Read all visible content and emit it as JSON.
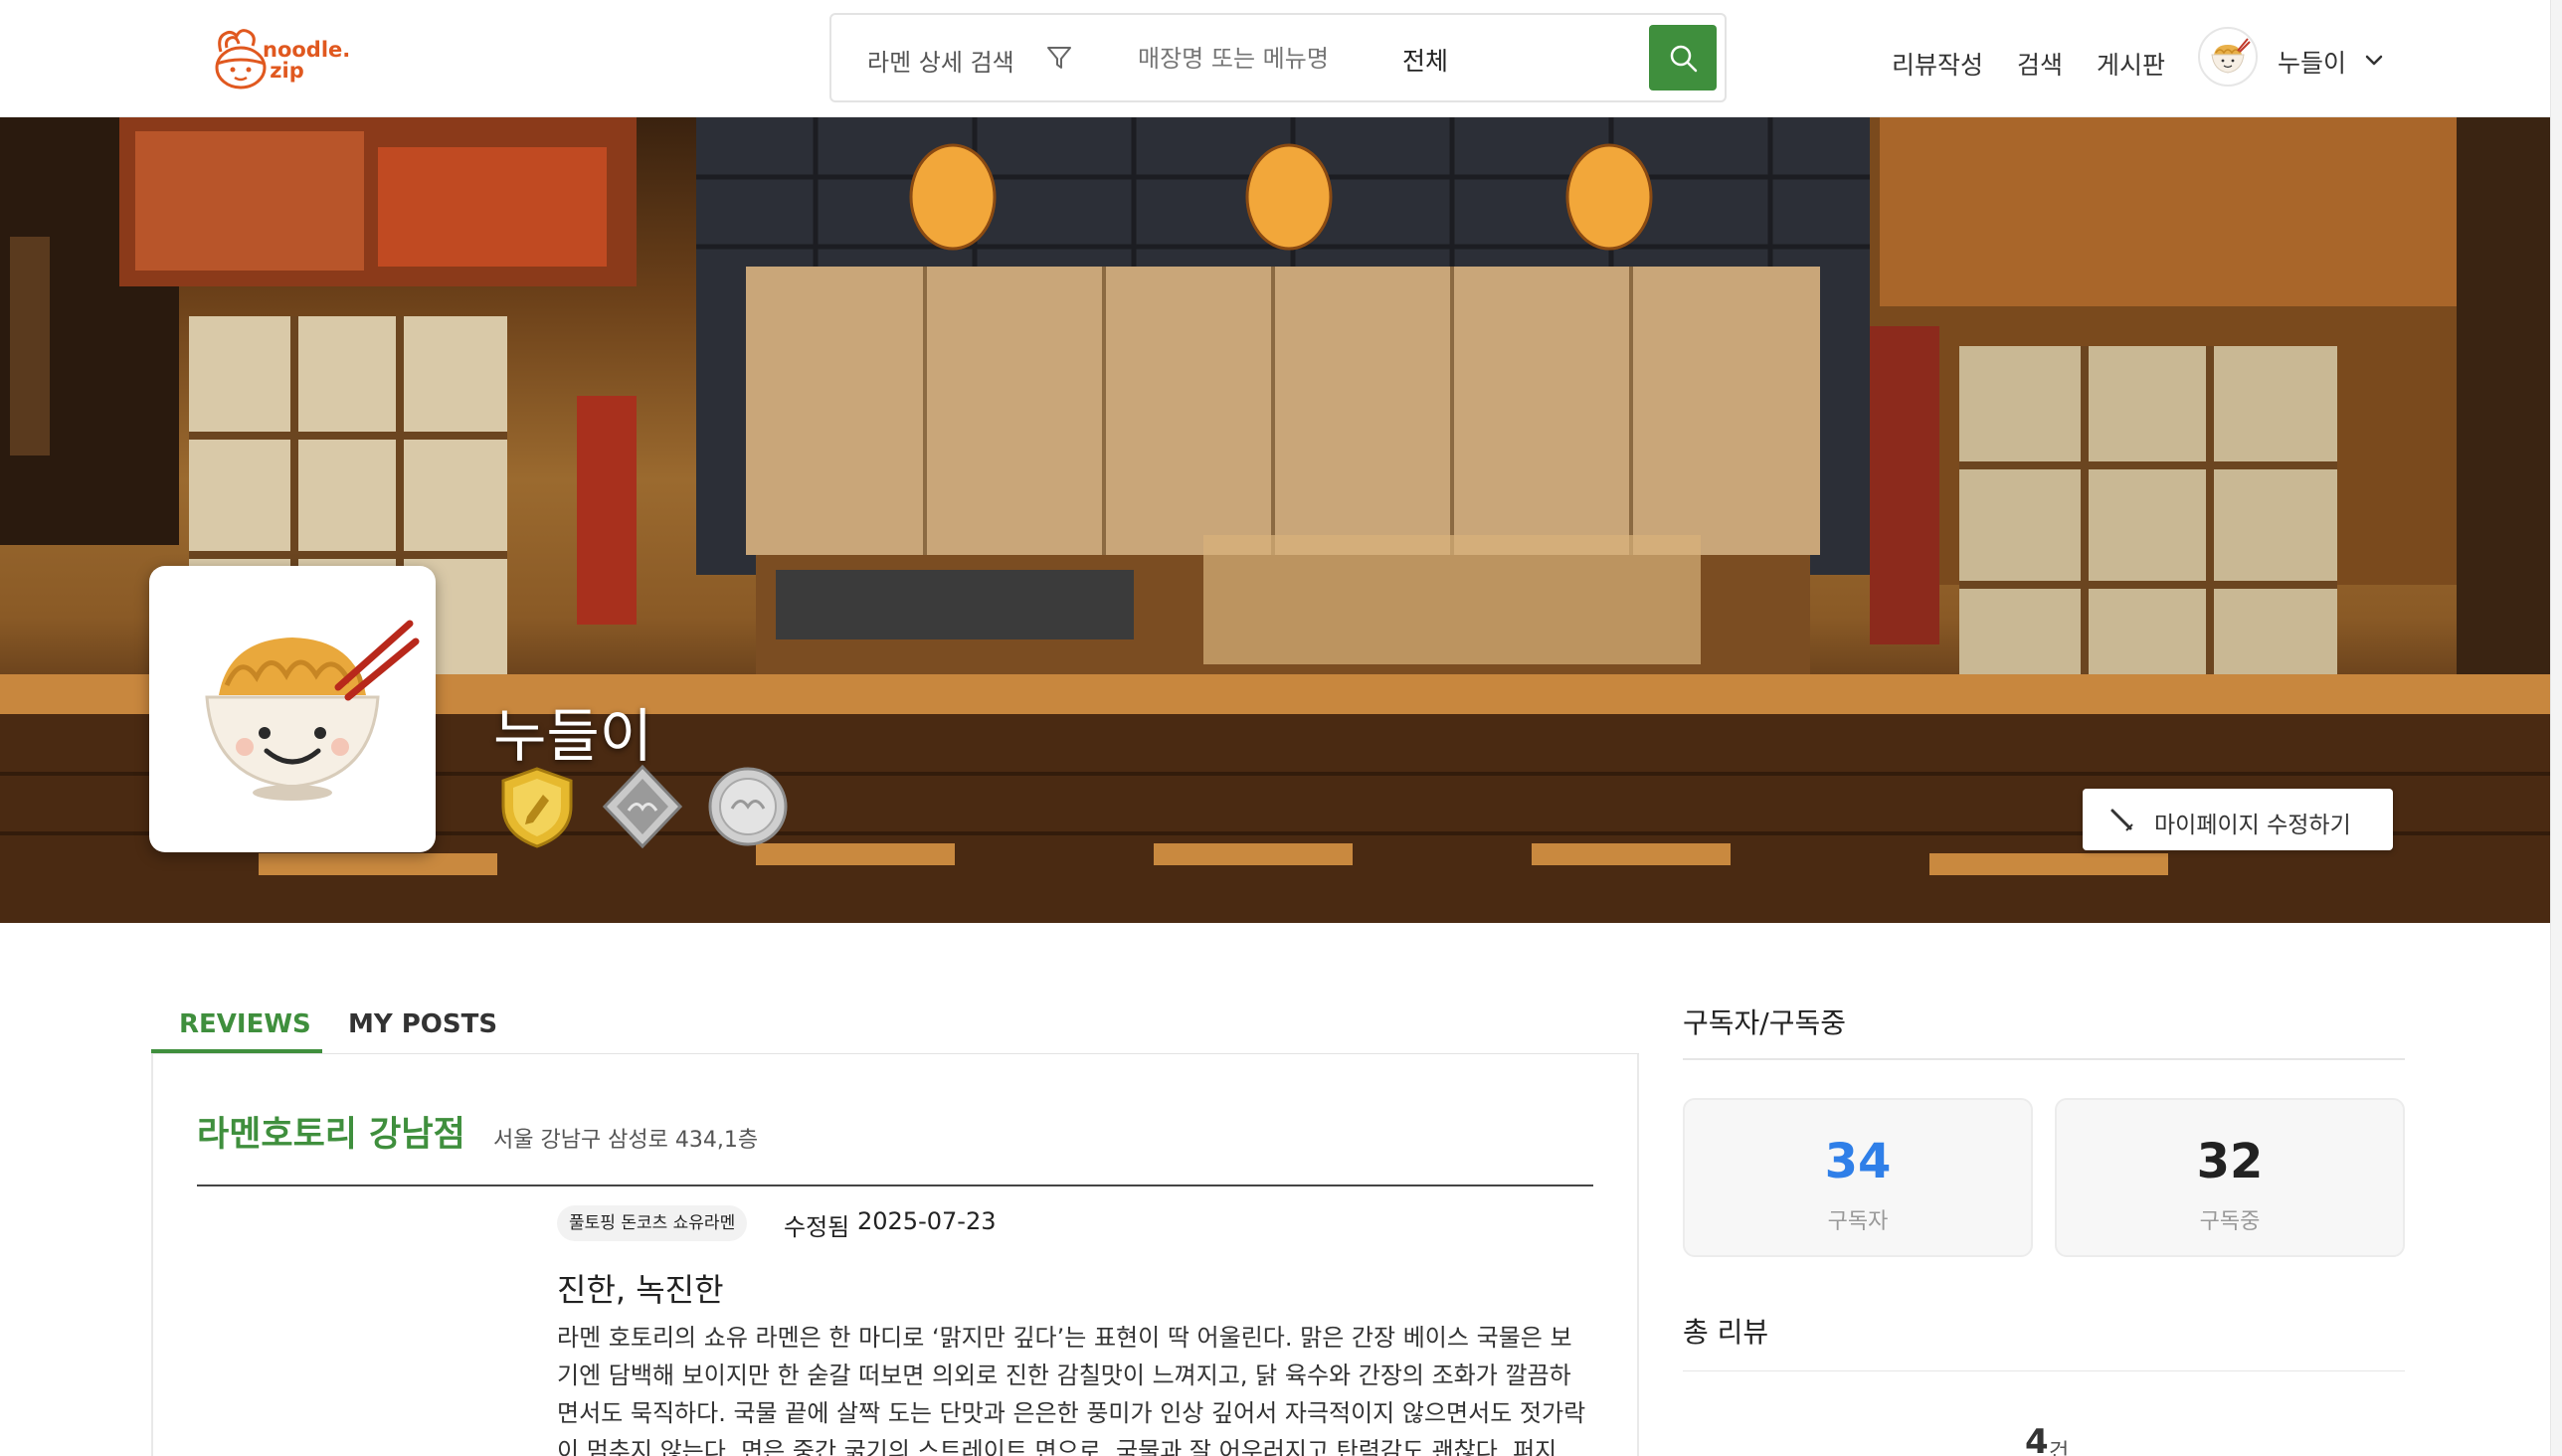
{
  "header": {
    "logo_text": "noodle.\nzip",
    "search_detail_label": "라멘 상세 검색",
    "search_placeholder": "매장명 또는 메뉴명",
    "search_scope": "전체",
    "nav": {
      "write_review": "리뷰작성",
      "search": "검색",
      "board": "게시판"
    },
    "user_name": "누들이"
  },
  "profile": {
    "name": "누들이",
    "badges": [
      "shield-badge-icon",
      "diamond-badge-icon",
      "coin-badge-icon"
    ],
    "edit_button_label": "마이페이지 수정하기"
  },
  "tabs": [
    {
      "label": "REVIEWS",
      "active": true
    },
    {
      "label": "MY POSTS",
      "active": false
    }
  ],
  "review": {
    "store_name": "라멘호토리 강남점",
    "store_address": "서울 강남구 삼성로 434,1층",
    "menu_tag": "풀토핑 돈코츠 쇼유라멘",
    "edited_label": "수정됨",
    "edited_date": "2025-07-23",
    "title": "진한, 녹진한",
    "body": "라멘 호토리의 쇼유 라멘은 한 마디로 ‘맑지만 깊다’는 표현이 딱 어울린다. 맑은 간장 베이스 국물은 보기엔 담백해 보이지만 한 숟갈 떠보면 의외로 진한 감칠맛이 느껴지고, 닭 육수와 간장의 조화가 깔끔하면서도 묵직하다. 국물 끝에 살짝 도는 단맛과 은은한 풍미가 인상 깊어서 자극적이지 않으면서도 젓가락이 멈추지 않는다. 면은 중간 굵기의 스트레이트 면으로, 국물과 잘 어우러지고 탄력감도 괜찮다. 퍼지"
  },
  "sidebar": {
    "subscription_title": "구독자/구독중",
    "subscribers_count": "34",
    "subscribers_label": "구독자",
    "following_count": "32",
    "following_label": "구독중",
    "total_reviews_title": "총 리뷰",
    "total_reviews_count": "4",
    "total_reviews_unit": "건"
  },
  "colors": {
    "brand_green": "#3f8f3d",
    "logo_orange": "#e0581f",
    "subscriber_blue": "#2f7fe8"
  }
}
